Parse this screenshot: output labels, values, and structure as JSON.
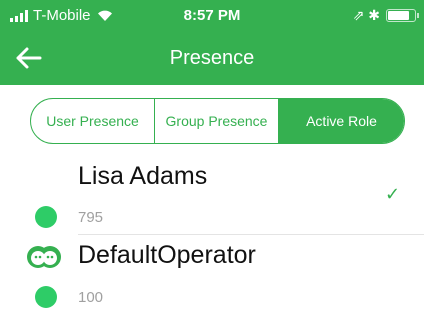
{
  "status_bar": {
    "carrier": "T-Mobile",
    "time": "8:57 PM",
    "right_symbols": "⇗ ✱"
  },
  "nav": {
    "title": "Presence",
    "back_icon": "arrow-left-icon"
  },
  "tabs": [
    {
      "label": "User Presence",
      "selected": false
    },
    {
      "label": "Group Presence",
      "selected": false
    },
    {
      "label": "Active Role",
      "selected": true
    }
  ],
  "list": [
    {
      "name": "Lisa Adams",
      "sub": "795",
      "status_color": "#2ecc67",
      "checked": true
    },
    {
      "name": "DefaultOperator",
      "sub": "100",
      "status_color": "#2ecc67",
      "icon": "group-icon"
    }
  ],
  "colors": {
    "accent": "#35b050",
    "status_online": "#2ecc67"
  }
}
